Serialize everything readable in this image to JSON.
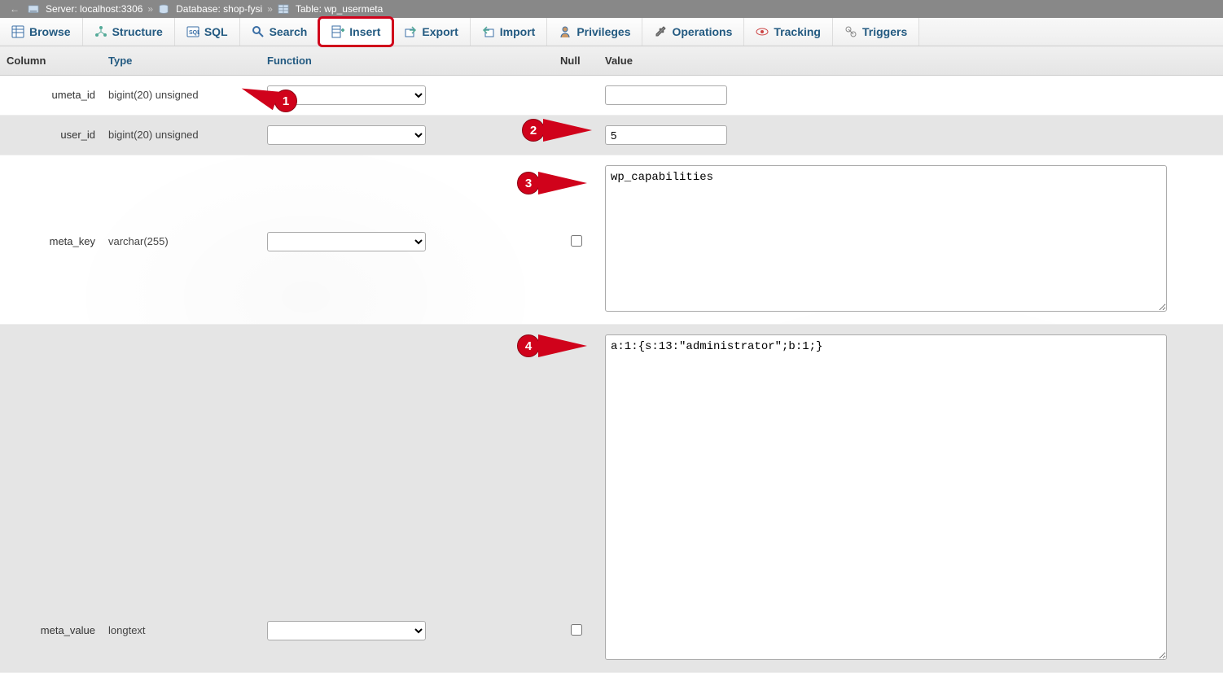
{
  "breadcrumb": {
    "server": {
      "label": "Server:",
      "value": "localhost:3306"
    },
    "database": {
      "label": "Database:",
      "value": "shop-fysi"
    },
    "table": {
      "label": "Table:",
      "value": "wp_usermeta"
    }
  },
  "tabs": {
    "browse": "Browse",
    "structure": "Structure",
    "sql": "SQL",
    "search": "Search",
    "insert": "Insert",
    "export": "Export",
    "import": "Import",
    "privileges": "Privileges",
    "operations": "Operations",
    "tracking": "Tracking",
    "triggers": "Triggers"
  },
  "headers": {
    "column": "Column",
    "type": "Type",
    "function": "Function",
    "null": "Null",
    "value": "Value"
  },
  "rows": [
    {
      "column": "umeta_id",
      "type": "bigint(20) unsigned",
      "null_allowed": false,
      "value": ""
    },
    {
      "column": "user_id",
      "type": "bigint(20) unsigned",
      "null_allowed": false,
      "value": "5"
    },
    {
      "column": "meta_key",
      "type": "varchar(255)",
      "null_allowed": true,
      "value": "wp_capabilities"
    },
    {
      "column": "meta_value",
      "type": "longtext",
      "null_allowed": true,
      "value": "a:1:{s:13:\"administrator\";b:1;}"
    }
  ],
  "callouts": {
    "c1": "1",
    "c2": "2",
    "c3": "3",
    "c4": "4"
  }
}
